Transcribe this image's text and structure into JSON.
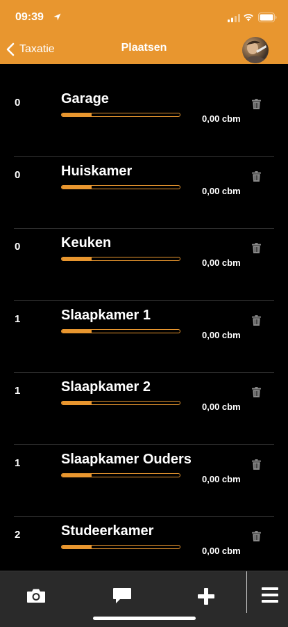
{
  "status_bar": {
    "time": "09:39"
  },
  "header": {
    "back_label": "Taxatie",
    "title": "Plaatsen"
  },
  "colors": {
    "accent": "#E8962F",
    "background": "#000000",
    "tabbar": "#2a2a2a"
  },
  "rooms": [
    {
      "count": "0",
      "name": "Garage",
      "volume": "0,00 cbm",
      "progress": 0.25
    },
    {
      "count": "0",
      "name": "Huiskamer",
      "volume": "0,00 cbm",
      "progress": 0.25
    },
    {
      "count": "0",
      "name": "Keuken",
      "volume": "0,00 cbm",
      "progress": 0.25
    },
    {
      "count": "1",
      "name": "Slaapkamer 1",
      "volume": "0,00 cbm",
      "progress": 0.25
    },
    {
      "count": "1",
      "name": "Slaapkamer 2",
      "volume": "0,00 cbm",
      "progress": 0.25
    },
    {
      "count": "1",
      "name": "Slaapkamer Ouders",
      "volume": "0,00 cbm",
      "progress": 0.25
    },
    {
      "count": "2",
      "name": "Studeerkamer",
      "volume": "0,00 cbm",
      "progress": 0.25
    }
  ],
  "tabbar": {
    "items": [
      {
        "icon": "camera-icon"
      },
      {
        "icon": "chat-icon"
      },
      {
        "icon": "plus-icon"
      },
      {
        "icon": "menu-icon"
      }
    ]
  }
}
